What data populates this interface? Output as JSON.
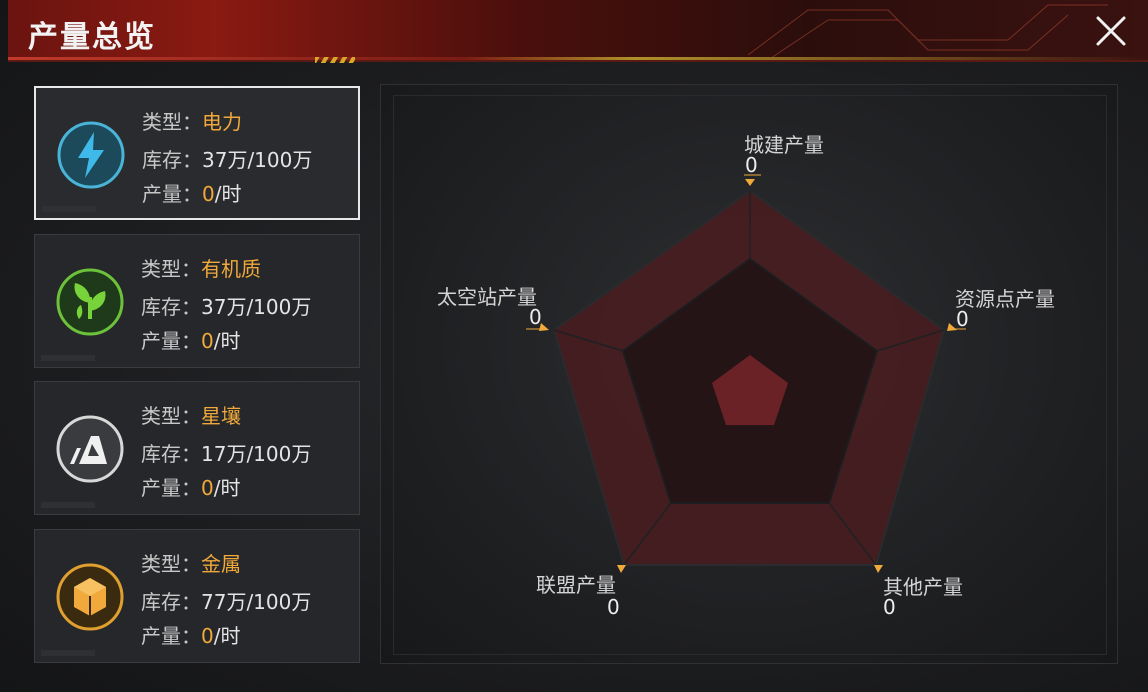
{
  "header": {
    "title": "产量总览"
  },
  "labels": {
    "type": "类型：",
    "stock": "库存：",
    "output": "产量："
  },
  "resources": [
    {
      "name": "电力",
      "stock": "37万/100万",
      "output": "0",
      "unit": "/时",
      "icon": "lightning-icon",
      "selected": true
    },
    {
      "name": "有机质",
      "stock": "37万/100万",
      "output": "0",
      "unit": "/时",
      "icon": "leaf-icon",
      "selected": false
    },
    {
      "name": "星壤",
      "stock": "17万/100万",
      "output": "0",
      "unit": "/时",
      "icon": "star-soil-icon",
      "selected": false
    },
    {
      "name": "金属",
      "stock": "77万/100万",
      "output": "0",
      "unit": "/时",
      "icon": "metal-cube-icon",
      "selected": false
    }
  ],
  "radar": {
    "axes": [
      {
        "label": "城建产量",
        "value": "0"
      },
      {
        "label": "资源点产量",
        "value": "0"
      },
      {
        "label": "其他产量",
        "value": "0"
      },
      {
        "label": "联盟产量",
        "value": "0"
      },
      {
        "label": "太空站产量",
        "value": "0"
      }
    ]
  },
  "colors": {
    "accent_gold": "#f0a93a",
    "header_red": "#8a1a12",
    "radar_fill": "#5a1e22"
  }
}
